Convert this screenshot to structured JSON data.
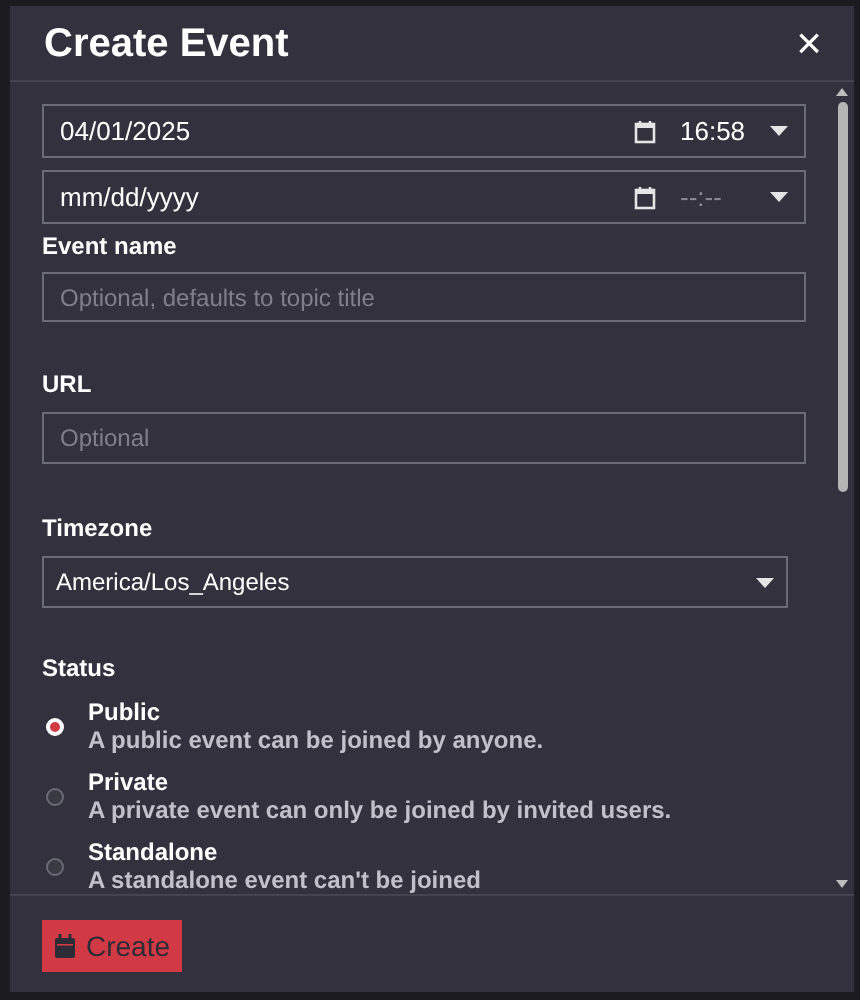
{
  "dialog": {
    "title": "Create Event",
    "close": "×"
  },
  "start": {
    "date": "04/01/2025",
    "time": "16:58"
  },
  "end": {
    "date_placeholder": "mm/dd/yyyy",
    "time_placeholder": "--:--"
  },
  "event_name": {
    "label": "Event name",
    "placeholder": "Optional, defaults to topic title"
  },
  "url": {
    "label": "URL",
    "placeholder": "Optional"
  },
  "timezone": {
    "label": "Timezone",
    "value": "America/Los_Angeles"
  },
  "status": {
    "label": "Status",
    "options": [
      {
        "title": "Public",
        "description": "A public event can be joined by anyone.",
        "selected": true
      },
      {
        "title": "Private",
        "description": "A private event can only be joined by invited users.",
        "selected": false
      },
      {
        "title": "Standalone",
        "description": "A standalone event can't be joined",
        "selected": false
      }
    ]
  },
  "footer": {
    "button": "Create"
  }
}
